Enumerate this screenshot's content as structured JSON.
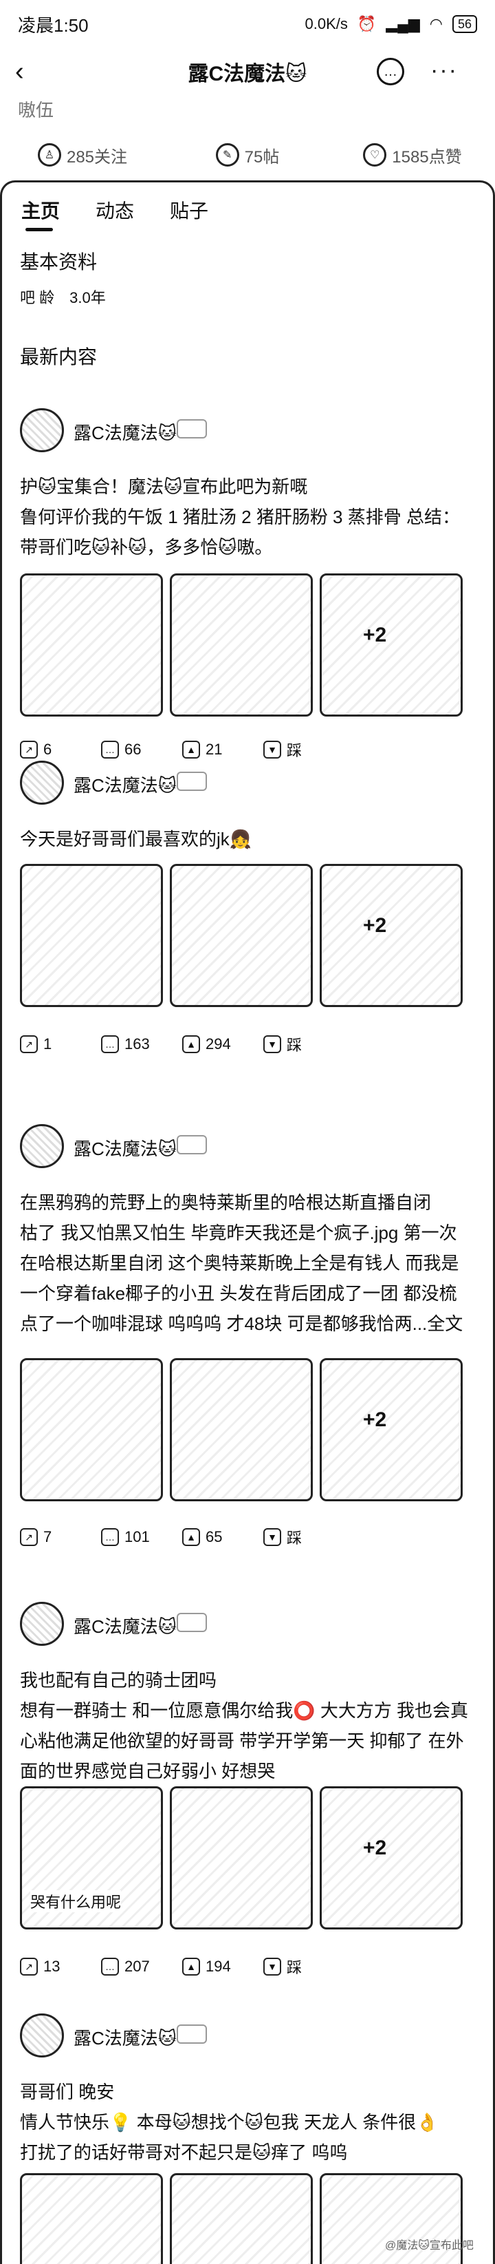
{
  "status_bar": {
    "time": "凌晨1:50",
    "network": "0.0K/s",
    "battery": "56"
  },
  "nav": {
    "title": "露C法魔法🐱"
  },
  "faded_text": "嗷伍",
  "stats": [
    {
      "icon": "users-icon",
      "label": "285关注"
    },
    {
      "icon": "pen-icon",
      "label": "75帖"
    },
    {
      "icon": "heart-icon",
      "label": "1585点赞"
    }
  ],
  "tabs": [
    {
      "label": "主页"
    },
    {
      "label": "动态"
    },
    {
      "label": "贴子"
    }
  ],
  "basic_info": {
    "title": "基本资料",
    "age_label": "吧 龄",
    "age_value": "3.0年"
  },
  "latest": {
    "title": "最新内容"
  },
  "posts": [
    {
      "author": "露C法魔法🐱",
      "text": "护🐱宝集合！魔法🐱宣布此吧为新嘅\n鲁何评价我的午饭 1 猪肚汤 2 猪肝肠粉 3 蒸排骨 总结：带哥们吃🐱补🐱，多多恰🐱嗷。",
      "images": [
        "",
        "",
        "+2"
      ],
      "caption": "",
      "actions": [
        "6",
        "66",
        "21",
        "踩"
      ]
    },
    {
      "author": "露C法魔法🐱",
      "text": "今天是好哥哥们最喜欢的jk👧",
      "images": [
        "",
        "",
        "+2"
      ],
      "caption": "",
      "actions": [
        "1",
        "163",
        "294",
        "踩"
      ]
    },
    {
      "author": "露C法魔法🐱",
      "text": "在黑鸦鸦的荒野上的奥特莱斯里的哈根达斯直播自闭\n枯了 我又怕黑又怕生 毕竟昨天我还是个疯子.jpg 第一次在哈根达斯里自闭 这个奥特莱斯晚上全是有钱人 而我是一个穿着fake椰子的小丑 头发在背后团成了一团 都没梳 点了一个咖啡混球 呜呜呜 才48块 可是都够我恰两...全文",
      "images": [
        "",
        "",
        "+2"
      ],
      "caption": "",
      "actions": [
        "7",
        "101",
        "65",
        "踩"
      ]
    },
    {
      "author": "露C法魔法🐱",
      "text": "我也配有自己的骑士团吗\n想有一群骑士 和一位愿意偶尔给我⭕ 大大方方 我也会真心粘他满足他欲望的好哥哥 带学开学第一天 抑郁了 在外面的世界感觉自己好弱小 好想哭",
      "images": [
        "",
        "",
        "+2"
      ],
      "caption": "哭有什么用呢",
      "actions": [
        "13",
        "207",
        "194",
        "踩"
      ]
    },
    {
      "author": "露C法魔法🐱",
      "text": "哥哥们 晚安\n情人节快乐💡 本母🐱想找个🐱包我 天龙人 条件很👌\n打扰了的话好带哥对不起只是🐱痒了 呜呜",
      "images": [
        "",
        "",
        ""
      ],
      "caption": "",
      "actions": []
    }
  ],
  "watermark": "@魔法🐱宣布此吧"
}
